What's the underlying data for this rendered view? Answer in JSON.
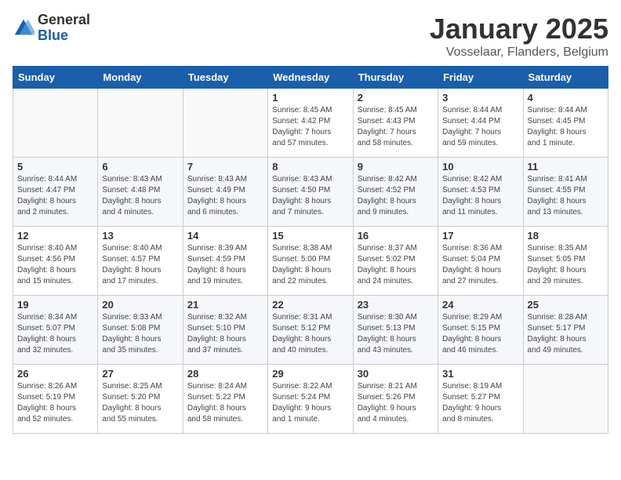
{
  "header": {
    "logo_general": "General",
    "logo_blue": "Blue",
    "month_title": "January 2025",
    "subtitle": "Vosselaar, Flanders, Belgium"
  },
  "days_of_week": [
    "Sunday",
    "Monday",
    "Tuesday",
    "Wednesday",
    "Thursday",
    "Friday",
    "Saturday"
  ],
  "weeks": [
    [
      {
        "day": "",
        "info": ""
      },
      {
        "day": "",
        "info": ""
      },
      {
        "day": "",
        "info": ""
      },
      {
        "day": "1",
        "info": "Sunrise: 8:45 AM\nSunset: 4:42 PM\nDaylight: 7 hours\nand 57 minutes."
      },
      {
        "day": "2",
        "info": "Sunrise: 8:45 AM\nSunset: 4:43 PM\nDaylight: 7 hours\nand 58 minutes."
      },
      {
        "day": "3",
        "info": "Sunrise: 8:44 AM\nSunset: 4:44 PM\nDaylight: 7 hours\nand 59 minutes."
      },
      {
        "day": "4",
        "info": "Sunrise: 8:44 AM\nSunset: 4:45 PM\nDaylight: 8 hours\nand 1 minute."
      }
    ],
    [
      {
        "day": "5",
        "info": "Sunrise: 8:44 AM\nSunset: 4:47 PM\nDaylight: 8 hours\nand 2 minutes."
      },
      {
        "day": "6",
        "info": "Sunrise: 8:43 AM\nSunset: 4:48 PM\nDaylight: 8 hours\nand 4 minutes."
      },
      {
        "day": "7",
        "info": "Sunrise: 8:43 AM\nSunset: 4:49 PM\nDaylight: 8 hours\nand 6 minutes."
      },
      {
        "day": "8",
        "info": "Sunrise: 8:43 AM\nSunset: 4:50 PM\nDaylight: 8 hours\nand 7 minutes."
      },
      {
        "day": "9",
        "info": "Sunrise: 8:42 AM\nSunset: 4:52 PM\nDaylight: 8 hours\nand 9 minutes."
      },
      {
        "day": "10",
        "info": "Sunrise: 8:42 AM\nSunset: 4:53 PM\nDaylight: 8 hours\nand 11 minutes."
      },
      {
        "day": "11",
        "info": "Sunrise: 8:41 AM\nSunset: 4:55 PM\nDaylight: 8 hours\nand 13 minutes."
      }
    ],
    [
      {
        "day": "12",
        "info": "Sunrise: 8:40 AM\nSunset: 4:56 PM\nDaylight: 8 hours\nand 15 minutes."
      },
      {
        "day": "13",
        "info": "Sunrise: 8:40 AM\nSunset: 4:57 PM\nDaylight: 8 hours\nand 17 minutes."
      },
      {
        "day": "14",
        "info": "Sunrise: 8:39 AM\nSunset: 4:59 PM\nDaylight: 8 hours\nand 19 minutes."
      },
      {
        "day": "15",
        "info": "Sunrise: 8:38 AM\nSunset: 5:00 PM\nDaylight: 8 hours\nand 22 minutes."
      },
      {
        "day": "16",
        "info": "Sunrise: 8:37 AM\nSunset: 5:02 PM\nDaylight: 8 hours\nand 24 minutes."
      },
      {
        "day": "17",
        "info": "Sunrise: 8:36 AM\nSunset: 5:04 PM\nDaylight: 8 hours\nand 27 minutes."
      },
      {
        "day": "18",
        "info": "Sunrise: 8:35 AM\nSunset: 5:05 PM\nDaylight: 8 hours\nand 29 minutes."
      }
    ],
    [
      {
        "day": "19",
        "info": "Sunrise: 8:34 AM\nSunset: 5:07 PM\nDaylight: 8 hours\nand 32 minutes."
      },
      {
        "day": "20",
        "info": "Sunrise: 8:33 AM\nSunset: 5:08 PM\nDaylight: 8 hours\nand 35 minutes."
      },
      {
        "day": "21",
        "info": "Sunrise: 8:32 AM\nSunset: 5:10 PM\nDaylight: 8 hours\nand 37 minutes."
      },
      {
        "day": "22",
        "info": "Sunrise: 8:31 AM\nSunset: 5:12 PM\nDaylight: 8 hours\nand 40 minutes."
      },
      {
        "day": "23",
        "info": "Sunrise: 8:30 AM\nSunset: 5:13 PM\nDaylight: 8 hours\nand 43 minutes."
      },
      {
        "day": "24",
        "info": "Sunrise: 8:29 AM\nSunset: 5:15 PM\nDaylight: 8 hours\nand 46 minutes."
      },
      {
        "day": "25",
        "info": "Sunrise: 8:28 AM\nSunset: 5:17 PM\nDaylight: 8 hours\nand 49 minutes."
      }
    ],
    [
      {
        "day": "26",
        "info": "Sunrise: 8:26 AM\nSunset: 5:19 PM\nDaylight: 8 hours\nand 52 minutes."
      },
      {
        "day": "27",
        "info": "Sunrise: 8:25 AM\nSunset: 5:20 PM\nDaylight: 8 hours\nand 55 minutes."
      },
      {
        "day": "28",
        "info": "Sunrise: 8:24 AM\nSunset: 5:22 PM\nDaylight: 8 hours\nand 58 minutes."
      },
      {
        "day": "29",
        "info": "Sunrise: 8:22 AM\nSunset: 5:24 PM\nDaylight: 9 hours\nand 1 minute."
      },
      {
        "day": "30",
        "info": "Sunrise: 8:21 AM\nSunset: 5:26 PM\nDaylight: 9 hours\nand 4 minutes."
      },
      {
        "day": "31",
        "info": "Sunrise: 8:19 AM\nSunset: 5:27 PM\nDaylight: 9 hours\nand 8 minutes."
      },
      {
        "day": "",
        "info": ""
      }
    ]
  ]
}
